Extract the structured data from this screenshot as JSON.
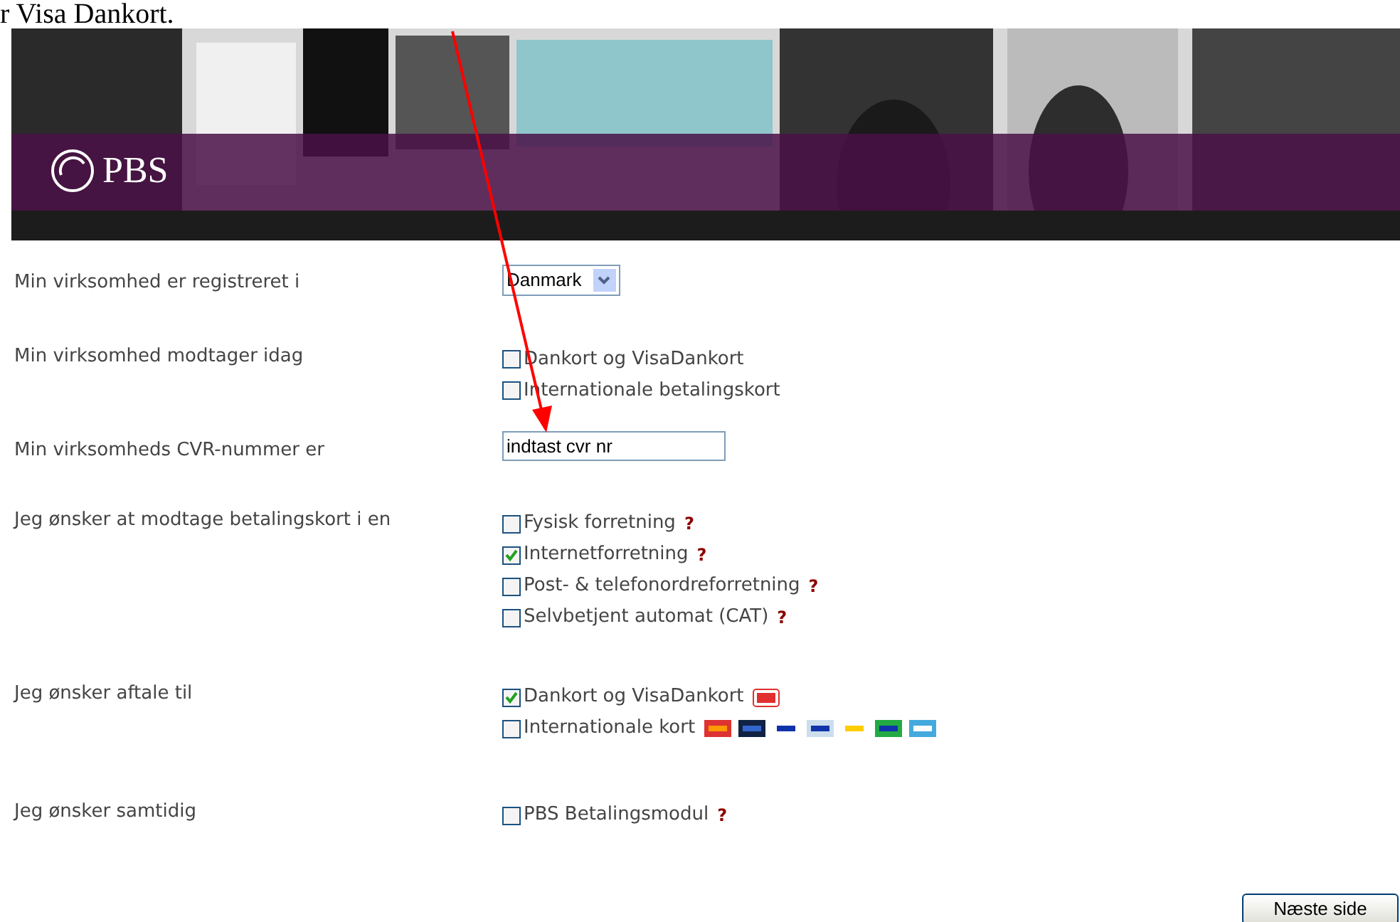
{
  "heading": "r Visa Dankort.",
  "banner": {
    "logo_text": "PBS"
  },
  "rows": [
    {
      "kind": "select",
      "label": "Min virksomhed er registreret i",
      "value": "Danmark"
    },
    {
      "kind": "checks",
      "label": "Min virksomhed modtager idag",
      "options": [
        {
          "label": "Dankort og VisaDankort",
          "checked": false
        },
        {
          "label": "Internationale betalingskort",
          "checked": false
        }
      ]
    },
    {
      "kind": "text",
      "label": "Min virksomheds CVR-nummer er",
      "value": "indtast cvr nr"
    },
    {
      "kind": "checks",
      "label": "Jeg ønsker at modtage betalingskort i en",
      "options": [
        {
          "label": "Fysisk forretning",
          "checked": false,
          "help": "?"
        },
        {
          "label": "Internetforretning",
          "checked": true,
          "help": "?"
        },
        {
          "label": "Post- & telefonordreforretning",
          "checked": false,
          "help": "?"
        },
        {
          "label": "Selvbetjent automat (CAT)",
          "checked": false,
          "help": "?"
        }
      ]
    },
    {
      "kind": "checks",
      "label": "Jeg ønsker aftale til",
      "options": [
        {
          "kind": "dk-logo",
          "label": "Dankort og VisaDankort",
          "checked": true
        },
        {
          "kind": "card-logos",
          "label": "Internationale kort",
          "checked": false
        }
      ]
    },
    {
      "kind": "checks",
      "label": "Jeg ønsker samtidig",
      "options": [
        {
          "label": "PBS Betalingsmodul",
          "checked": false,
          "help": "?"
        }
      ]
    }
  ],
  "next_button": "Næste side"
}
